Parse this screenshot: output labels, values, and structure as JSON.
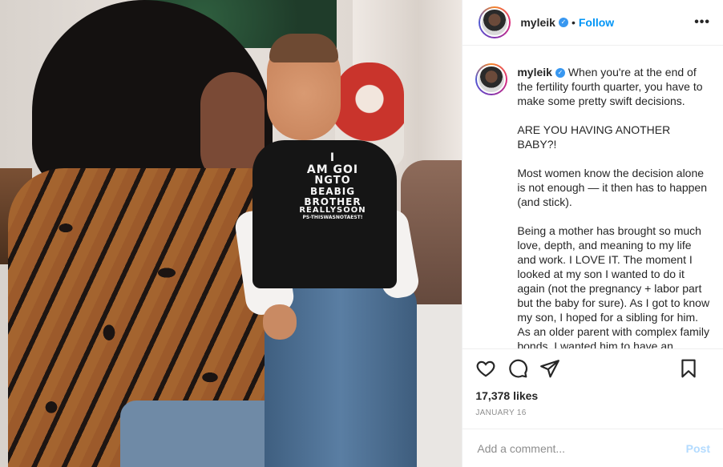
{
  "post": {
    "username": "myleik",
    "follow_label": "Follow",
    "dot": "•",
    "more_label": "•••",
    "photo_shirt_lines": [
      "I",
      "AM GOI",
      "NGTO",
      "BEABIG",
      "BROTHER",
      "REALLYSOON",
      "PS-THISWASNOTAEST!"
    ],
    "caption": {
      "author": "myleik",
      "paragraphs": [
        "When you're at the end of the fertility fourth quarter, you have to make some pretty swift decisions.",
        "ARE YOU HAVING ANOTHER BABY?!",
        "Most women know the decision alone is not enough — it then has to happen (and stick).",
        "Being a mother has brought so much love, depth, and meaning to my life and work. I LOVE IT. The moment I looked at my son I wanted to do it again (not the pregnancy + labor part but the baby for sure). As I got to know my son, I hoped for a sibling for him. As an older parent with complex family bonds, I wanted him to have an immediate family member to"
      ]
    },
    "likes": "17,378 likes",
    "date": "JANUARY 16",
    "comment": {
      "placeholder": "Add a comment...",
      "post_label": "Post"
    },
    "icons": [
      "verified-badge-icon",
      "more-options-icon",
      "heart-icon",
      "comment-icon",
      "share-icon",
      "bookmark-icon"
    ],
    "colors": {
      "accent": "#0095f6",
      "verified": "#3897f0",
      "post_disabled": "#b3dbff",
      "muted": "#8e8e8e",
      "text": "#262626"
    }
  }
}
